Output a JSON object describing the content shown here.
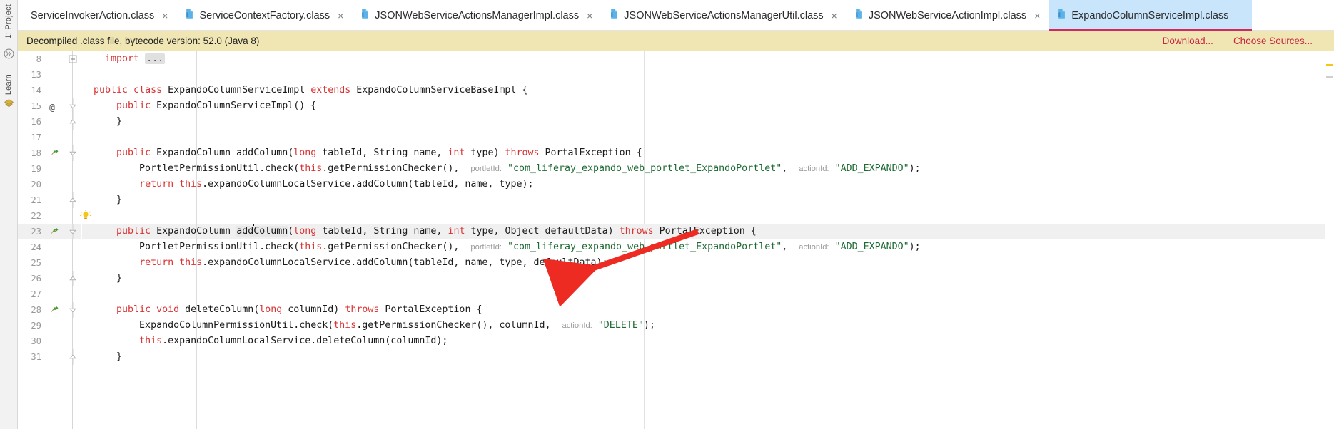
{
  "window": {
    "app": "IntelliJ IDEA",
    "view": "decompiled-class-editor"
  },
  "rail": {
    "project_label": "1: Project",
    "learn_label": "Learn",
    "idea_icon": "idea-circle-icon",
    "learn_icon": "learn-badge-icon"
  },
  "tabs": [
    {
      "label": "ServiceInvokerAction.class",
      "icon": "java-class-icon",
      "close": "×",
      "active": false
    },
    {
      "label": "ServiceContextFactory.class",
      "icon": "java-class-icon",
      "close": "×",
      "active": false
    },
    {
      "label": "JSONWebServiceActionsManagerImpl.class",
      "icon": "java-class-icon",
      "close": "×",
      "active": false
    },
    {
      "label": "JSONWebServiceActionsManagerUtil.class",
      "icon": "java-class-icon",
      "close": "×",
      "active": false
    },
    {
      "label": "JSONWebServiceActionImpl.class",
      "icon": "java-class-icon",
      "close": "×",
      "active": false
    },
    {
      "label": "ExpandoColumnServiceImpl.class",
      "icon": "java-class-icon",
      "close": "×",
      "active": true
    }
  ],
  "banner": {
    "message": "Decompiled .class file, bytecode version: 52.0 (Java 8)",
    "download_label": "Download...",
    "choose_sources_label": "Choose Sources...",
    "background": "#f0e6b4",
    "link_color": "#c7263f"
  },
  "editor": {
    "caret_line": 23,
    "colors": {
      "keyword": "#d93333",
      "string": "#1d6b33",
      "hint": "#9a9a9a",
      "caret_line_bg": "#f0f0f0",
      "annotation_arrow": "#ee2b23"
    },
    "lines": [
      {
        "num": "8",
        "marker": "",
        "fold": "collapsed",
        "indent": 0,
        "segments": [
          {
            "t": "    ",
            "c": ""
          },
          {
            "t": "import ",
            "c": "kw"
          },
          {
            "t": "...",
            "c": "ell"
          }
        ]
      },
      {
        "num": "13",
        "marker": "",
        "fold": "",
        "indent": 0,
        "segments": []
      },
      {
        "num": "14",
        "marker": "",
        "fold": "",
        "indent": 0,
        "segments": [
          {
            "t": "  ",
            "c": ""
          },
          {
            "t": "public class",
            "c": "kw"
          },
          {
            "t": " ExpandoColumnServiceImpl ",
            "c": ""
          },
          {
            "t": "extends",
            "c": "kw"
          },
          {
            "t": " ExpandoColumnServiceBaseImpl {",
            "c": ""
          }
        ]
      },
      {
        "num": "15",
        "marker": "@",
        "fold": "open",
        "indent": 0,
        "segments": [
          {
            "t": "      ",
            "c": ""
          },
          {
            "t": "public",
            "c": "kw"
          },
          {
            "t": " ExpandoColumnServiceImpl() {",
            "c": ""
          }
        ]
      },
      {
        "num": "16",
        "marker": "",
        "fold": "close",
        "indent": 1,
        "segments": [
          {
            "t": "      }",
            "c": ""
          }
        ]
      },
      {
        "num": "17",
        "marker": "",
        "fold": "",
        "indent": 0,
        "segments": []
      },
      {
        "num": "18",
        "marker": "override",
        "fold": "open",
        "indent": 1,
        "segments": [
          {
            "t": "      ",
            "c": ""
          },
          {
            "t": "public",
            "c": "kw"
          },
          {
            "t": " ExpandoColumn addColumn(",
            "c": ""
          },
          {
            "t": "long",
            "c": "kw"
          },
          {
            "t": " tableId, String name, ",
            "c": ""
          },
          {
            "t": "int",
            "c": "kw"
          },
          {
            "t": " type) ",
            "c": ""
          },
          {
            "t": "throws",
            "c": "kw"
          },
          {
            "t": " PortalException {",
            "c": ""
          }
        ]
      },
      {
        "num": "19",
        "marker": "",
        "fold": "",
        "indent": 2,
        "segments": [
          {
            "t": "          PortletPermissionUtil.check(",
            "c": ""
          },
          {
            "t": "this",
            "c": "kw"
          },
          {
            "t": ".getPermissionChecker(),  ",
            "c": ""
          },
          {
            "t": "portletId:",
            "c": "hint"
          },
          {
            "t": " ",
            "c": ""
          },
          {
            "t": "\"com_liferay_expando_web_portlet_ExpandoPortlet\"",
            "c": "str"
          },
          {
            "t": ",  ",
            "c": ""
          },
          {
            "t": "actionId:",
            "c": "hint"
          },
          {
            "t": " ",
            "c": ""
          },
          {
            "t": "\"ADD_EXPANDO\"",
            "c": "str"
          },
          {
            "t": ");",
            "c": ""
          }
        ]
      },
      {
        "num": "20",
        "marker": "",
        "fold": "",
        "indent": 2,
        "segments": [
          {
            "t": "          ",
            "c": ""
          },
          {
            "t": "return",
            "c": "kw"
          },
          {
            "t": " ",
            "c": ""
          },
          {
            "t": "this",
            "c": "kw"
          },
          {
            "t": ".expandoColumnLocalService.addColumn(tableId, name, type);",
            "c": ""
          }
        ]
      },
      {
        "num": "21",
        "marker": "",
        "fold": "close",
        "indent": 1,
        "segments": [
          {
            "t": "      }",
            "c": ""
          }
        ]
      },
      {
        "num": "22",
        "marker": "",
        "fold": "",
        "indent": 0,
        "bulb": true,
        "segments": []
      },
      {
        "num": "23",
        "marker": "override",
        "fold": "open",
        "indent": 1,
        "caret": true,
        "segments": [
          {
            "t": "      ",
            "c": ""
          },
          {
            "t": "public",
            "c": "kw"
          },
          {
            "t": " ExpandoColumn ",
            "c": ""
          },
          {
            "t": "add",
            "c": "ident-hl"
          },
          {
            "t": "CARET",
            "c": "caret"
          },
          {
            "t": "Column",
            "c": "ident-hl"
          },
          {
            "t": "(",
            "c": ""
          },
          {
            "t": "long",
            "c": "kw"
          },
          {
            "t": " tableId, String name, ",
            "c": ""
          },
          {
            "t": "int",
            "c": "kw"
          },
          {
            "t": " type, Object defaultData) ",
            "c": ""
          },
          {
            "t": "throws",
            "c": "kw"
          },
          {
            "t": " PortalException {",
            "c": ""
          }
        ]
      },
      {
        "num": "24",
        "marker": "",
        "fold": "",
        "indent": 2,
        "segments": [
          {
            "t": "          PortletPermissionUtil.check(",
            "c": ""
          },
          {
            "t": "this",
            "c": "kw"
          },
          {
            "t": ".getPermissionChecker(),  ",
            "c": ""
          },
          {
            "t": "portletId:",
            "c": "hint"
          },
          {
            "t": " ",
            "c": ""
          },
          {
            "t": "\"com_liferay_expando_web_portlet_ExpandoPortlet\"",
            "c": "str"
          },
          {
            "t": ",  ",
            "c": ""
          },
          {
            "t": "actionId:",
            "c": "hint"
          },
          {
            "t": " ",
            "c": ""
          },
          {
            "t": "\"ADD_EXPANDO\"",
            "c": "str"
          },
          {
            "t": ");",
            "c": ""
          }
        ]
      },
      {
        "num": "25",
        "marker": "",
        "fold": "",
        "indent": 2,
        "segments": [
          {
            "t": "          ",
            "c": ""
          },
          {
            "t": "return",
            "c": "kw"
          },
          {
            "t": " ",
            "c": ""
          },
          {
            "t": "this",
            "c": "kw"
          },
          {
            "t": ".expandoColumnLocalService.addColumn(tableId, name, type, defaultData);",
            "c": ""
          }
        ]
      },
      {
        "num": "26",
        "marker": "",
        "fold": "close",
        "indent": 1,
        "segments": [
          {
            "t": "      }",
            "c": ""
          }
        ]
      },
      {
        "num": "27",
        "marker": "",
        "fold": "",
        "indent": 0,
        "segments": []
      },
      {
        "num": "28",
        "marker": "override",
        "fold": "open",
        "indent": 1,
        "segments": [
          {
            "t": "      ",
            "c": ""
          },
          {
            "t": "public",
            "c": "kw"
          },
          {
            "t": " ",
            "c": ""
          },
          {
            "t": "void",
            "c": "kw"
          },
          {
            "t": " deleteColumn(",
            "c": ""
          },
          {
            "t": "long",
            "c": "kw"
          },
          {
            "t": " columnId) ",
            "c": ""
          },
          {
            "t": "throws",
            "c": "kw"
          },
          {
            "t": " PortalException {",
            "c": ""
          }
        ]
      },
      {
        "num": "29",
        "marker": "",
        "fold": "",
        "indent": 2,
        "segments": [
          {
            "t": "          ExpandoColumnPermissionUtil.check(",
            "c": ""
          },
          {
            "t": "this",
            "c": "kw"
          },
          {
            "t": ".getPermissionChecker(), columnId,  ",
            "c": ""
          },
          {
            "t": "actionId:",
            "c": "hint"
          },
          {
            "t": " ",
            "c": ""
          },
          {
            "t": "\"DELETE\"",
            "c": "str"
          },
          {
            "t": ");",
            "c": ""
          }
        ]
      },
      {
        "num": "30",
        "marker": "",
        "fold": "",
        "indent": 2,
        "segments": [
          {
            "t": "          ",
            "c": ""
          },
          {
            "t": "this",
            "c": "kw"
          },
          {
            "t": ".expandoColumnLocalService.deleteColumn(columnId);",
            "c": ""
          }
        ]
      },
      {
        "num": "31",
        "marker": "",
        "fold": "close",
        "indent": 1,
        "segments": [
          {
            "t": "      }",
            "c": ""
          }
        ]
      }
    ]
  },
  "annotation": {
    "type": "red-arrow",
    "color": "#ee2b23",
    "points_to": "line 23 addColumn signature"
  }
}
